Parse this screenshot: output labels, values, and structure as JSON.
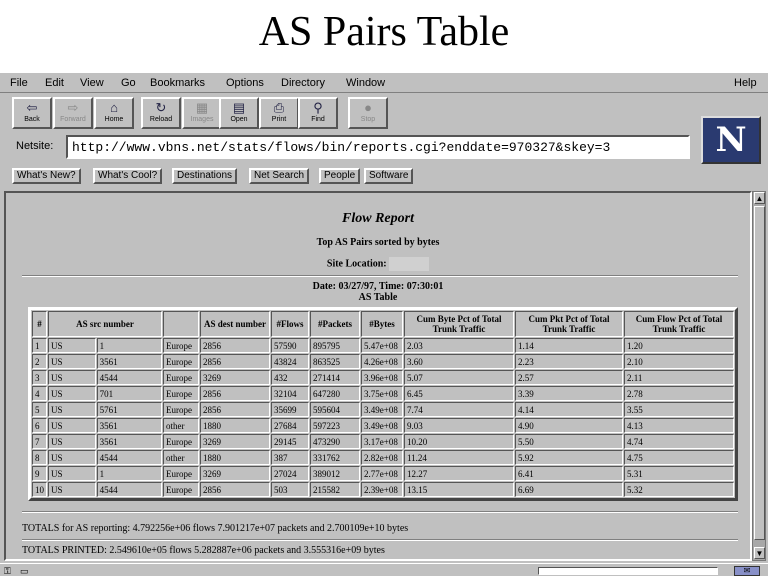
{
  "slide": {
    "title": "AS Pairs Table"
  },
  "browser": {
    "menu": [
      "File",
      "Edit",
      "View",
      "Go",
      "Bookmarks",
      "Options",
      "Directory",
      "Window"
    ],
    "help_label": "Help",
    "toolbar": [
      {
        "label": "Back",
        "icon": "back-arrow-icon",
        "glyph": "⇦"
      },
      {
        "label": "Forward",
        "icon": "forward-arrow-icon",
        "glyph": "⇨"
      },
      {
        "label": "Home",
        "icon": "home-icon",
        "glyph": "⌂"
      },
      {
        "label": "Reload",
        "icon": "reload-icon",
        "glyph": "↻"
      },
      {
        "label": "Images",
        "icon": "images-icon",
        "glyph": "▦"
      },
      {
        "label": "Open",
        "icon": "open-icon",
        "glyph": "▤"
      },
      {
        "label": "Print",
        "icon": "print-icon",
        "glyph": "⎙"
      },
      {
        "label": "Find",
        "icon": "find-icon",
        "glyph": "⚲"
      },
      {
        "label": "Stop",
        "icon": "stop-icon",
        "glyph": "●"
      }
    ],
    "logo_letter": "N",
    "netsite_label": "Netsite:",
    "url": "http://www.vbns.net/stats/flows/bin/reports.cgi?enddate=970327&skey=3",
    "directory_buttons": [
      "What's New?",
      "What's Cool?",
      "Destinations",
      "Net Search",
      "People",
      "Software"
    ]
  },
  "report": {
    "title": "Flow Report",
    "subtitle": "Top AS Pairs sorted by bytes",
    "site_location_label": "Site Location:",
    "date_line": "Date: 03/27/97, Time: 07:30:01",
    "table_caption": "AS Table",
    "columns": [
      "#",
      "AS src number",
      "",
      "AS dest number",
      "#Flows",
      "#Packets",
      "#Bytes",
      "Cum Byte Pct of Total Trunk Traffic",
      "Cum Pkt Pct of Total Trunk Traffic",
      "Cum Flow Pct of Total Trunk Traffic"
    ],
    "rows": [
      [
        "1",
        "US",
        "1",
        "Europe",
        "2856",
        "57590",
        "895795",
        "5.47e+08",
        "2.03",
        "1.14",
        "1.20"
      ],
      [
        "2",
        "US",
        "3561",
        "Europe",
        "2856",
        "43824",
        "863525",
        "4.26e+08",
        "3.60",
        "2.23",
        "2.10"
      ],
      [
        "3",
        "US",
        "4544",
        "Europe",
        "3269",
        "432",
        "271414",
        "3.96e+08",
        "5.07",
        "2.57",
        "2.11"
      ],
      [
        "4",
        "US",
        "701",
        "Europe",
        "2856",
        "32104",
        "647280",
        "3.75e+08",
        "6.45",
        "3.39",
        "2.78"
      ],
      [
        "5",
        "US",
        "5761",
        "Europe",
        "2856",
        "35699",
        "595604",
        "3.49e+08",
        "7.74",
        "4.14",
        "3.55"
      ],
      [
        "6",
        "US",
        "3561",
        "other",
        "1880",
        "27684",
        "597223",
        "3.49e+08",
        "9.03",
        "4.90",
        "4.13"
      ],
      [
        "7",
        "US",
        "3561",
        "Europe",
        "3269",
        "29145",
        "473290",
        "3.17e+08",
        "10.20",
        "5.50",
        "4.74"
      ],
      [
        "8",
        "US",
        "4544",
        "other",
        "1880",
        "387",
        "331762",
        "2.82e+08",
        "11.24",
        "5.92",
        "4.75"
      ],
      [
        "9",
        "US",
        "1",
        "Europe",
        "3269",
        "27024",
        "389012",
        "2.77e+08",
        "12.27",
        "6.41",
        "5.31"
      ],
      [
        "10",
        "US",
        "4544",
        "Europe",
        "2856",
        "503",
        "215582",
        "2.39e+08",
        "13.15",
        "6.69",
        "5.32"
      ]
    ],
    "totals_reporting": "TOTALS for AS reporting: 4.792256e+06 flows 7.901217e+07 packets and 2.700109e+10 bytes",
    "totals_printed": "TOTALS PRINTED: 2.549610e+05 flows 5.282887e+06 packets and 3.555316e+09 bytes"
  }
}
